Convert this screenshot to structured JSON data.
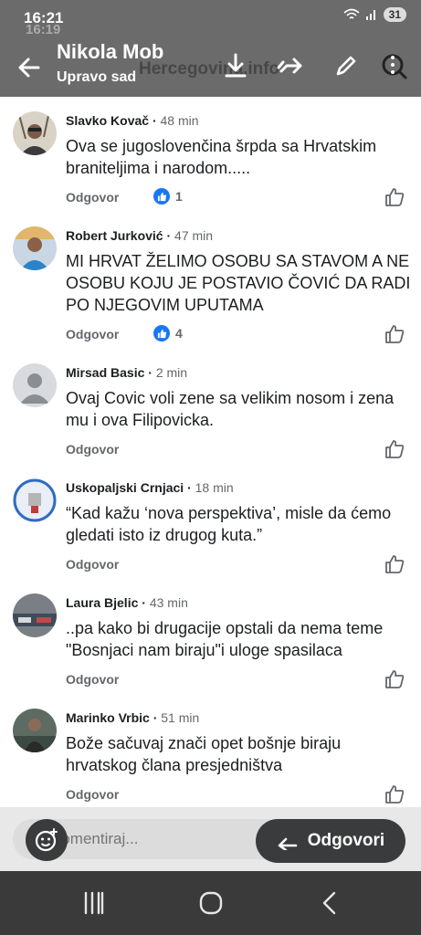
{
  "status_bar": {
    "time": "16:21",
    "time_ghost": "16:19",
    "battery": "31"
  },
  "header": {
    "name": "Nikola Mob",
    "subtitle": "Upravo sad",
    "ghost_site": "Hercegovina.info"
  },
  "comments": [
    {
      "author": "Slavko Kovač",
      "time": "48 min",
      "text": "Ova se jugoslovenčina šrpda sa Hrvatskim braniteljima i narodom.....",
      "reply": "Odgovor",
      "likes": "1"
    },
    {
      "author": "Robert Jurković",
      "time": "47 min",
      "text": "MI HRVAT ŽELIMO OSOBU SA STAVOM A NE OSOBU KOJU JE POSTAVIO ČOVIĆ DA RADI PO NJEGOVIM UPUTAMA",
      "reply": "Odgovor",
      "likes": "4"
    },
    {
      "author": "Mirsad Basic",
      "time": "2 min",
      "text": "Ovaj Covic voli zene sa velikim nosom i zena mu i ova Filipovicka.",
      "reply": "Odgovor",
      "likes": ""
    },
    {
      "author": "Uskopaljski Crnjaci",
      "time": "18 min",
      "text": "“Kad kažu ‘nova perspektiva’, misle da ćemo gledati isto iz drugog kuta.”",
      "reply": "Odgovor",
      "likes": ""
    },
    {
      "author": "Laura Bjelic",
      "time": "43 min",
      "text": "..pa kako bi drugacije opstali da nema teme \"Bosnjaci nam biraju\"i uloge spasilaca",
      "reply": "Odgovor",
      "likes": ""
    },
    {
      "author": "Marinko Vrbic",
      "time": "51 min",
      "text": "Bože sačuvaj znači opet bošnje biraju hrvatskog člana presjedništva",
      "reply": "Odgovor",
      "likes": ""
    }
  ],
  "composer": {
    "placeholder": "Komentiraj...",
    "reply_label": "Odgovori"
  },
  "colors": {
    "header_bg": "#6b6b6b",
    "like_blue": "#1877f2",
    "nav_bg": "#3a3a3a"
  }
}
